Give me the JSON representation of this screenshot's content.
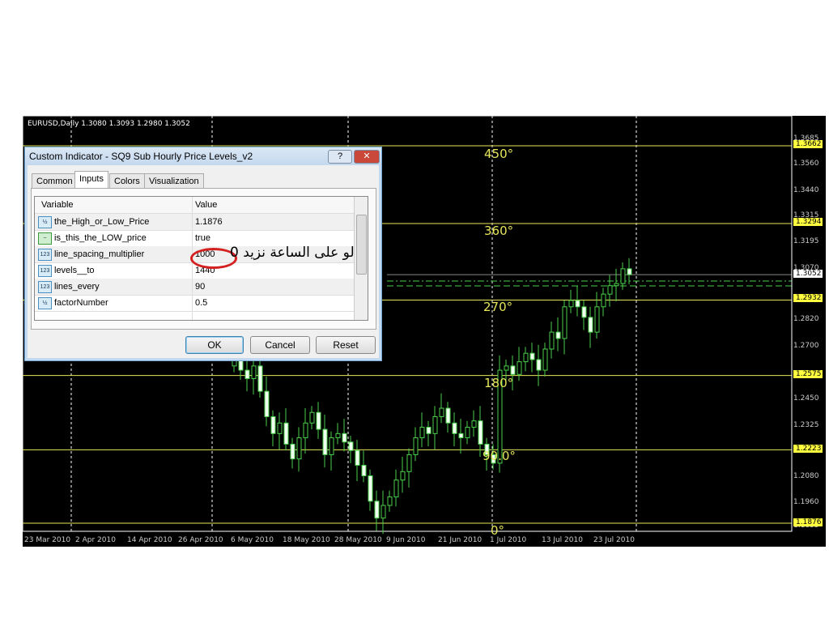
{
  "chart": {
    "symbol_info": "EURUSD,Daily  1.3080 1.3093 1.2980 1.3052",
    "price_ticks": [
      "1.3685",
      "1.3560",
      "1.3440",
      "1.3315",
      "1.3195",
      "1.3070",
      "1.2820",
      "1.2700",
      "1.2450",
      "1.2325",
      "1.2205",
      "1.2080",
      "1.1960",
      "1.1835"
    ],
    "level_tags": [
      "1.3662",
      "1.3294",
      "1.2932",
      "1.2575",
      "1.2223",
      "1.1876"
    ],
    "current_price": "1.3052",
    "degree_labels": [
      "450°",
      "360°",
      "270°",
      "180°",
      "90.0°",
      "0°"
    ],
    "dates": [
      "23 Mar 2010",
      "2 Apr 2010",
      "14 Apr 2010",
      "26 Apr 2010",
      "6 May 2010",
      "18 May 2010",
      "28 May 2010",
      "9 Jun 2010",
      "21 Jun 2010",
      "1 Jul 2010",
      "13 Jul 2010",
      "23 Jul 2010"
    ],
    "colors": {
      "background": "#000000",
      "candle": "#4ad04a",
      "level_line": "#e6e65a",
      "tag": "#ffff40"
    }
  },
  "chart_data": {
    "type": "candlestick",
    "symbol": "EURUSD",
    "timeframe": "Daily",
    "ylim": [
      1.1835,
      1.3685
    ],
    "closes": [
      1.265,
      1.26,
      1.256,
      1.262,
      1.25,
      1.238,
      1.23,
      1.235,
      1.225,
      1.218,
      1.228,
      1.235,
      1.24,
      1.232,
      1.22,
      1.228,
      1.23,
      1.226,
      1.222,
      1.215,
      1.21,
      1.198,
      1.19,
      1.196,
      1.2,
      1.208,
      1.212,
      1.22,
      1.228,
      1.233,
      1.23,
      1.238,
      1.242,
      1.235,
      1.23,
      1.228,
      1.233,
      1.236,
      1.225,
      1.22,
      1.216,
      1.26,
      1.262,
      1.258,
      1.264,
      1.268,
      1.265,
      1.26,
      1.27,
      1.278,
      1.275,
      1.29,
      1.293,
      1.29,
      1.285,
      1.278,
      1.29,
      1.296,
      1.3,
      1.301,
      1.308,
      1.3052
    ],
    "levels": [
      1.3662,
      1.3294,
      1.2932,
      1.2575,
      1.2223,
      1.1876
    ]
  },
  "dialog": {
    "title": "Custom Indicator - SQ9 Sub Hourly Price Levels_v2",
    "help": "?",
    "close": "✕",
    "tabs": [
      "Common",
      "Inputs",
      "Colors",
      "Visualization"
    ],
    "headers": [
      "Variable",
      "Value"
    ],
    "rows": [
      {
        "icon": "½",
        "name": "the_High_or_Low_Price",
        "value": "1.1876"
      },
      {
        "icon": "~",
        "name": "is_this_the_LOW_price",
        "value": "true"
      },
      {
        "icon": "123",
        "name": "line_spacing_multiplier",
        "value": "1000"
      },
      {
        "icon": "123",
        "name": "levels__to",
        "value": "1440"
      },
      {
        "icon": "123",
        "name": "lines_every",
        "value": "90"
      },
      {
        "icon": "½",
        "name": "factorNumber",
        "value": "0.5"
      }
    ],
    "ok": "OK",
    "cancel": "Cancel",
    "reset": "Reset"
  },
  "annotation": "لو على الساعة نزيد 0"
}
